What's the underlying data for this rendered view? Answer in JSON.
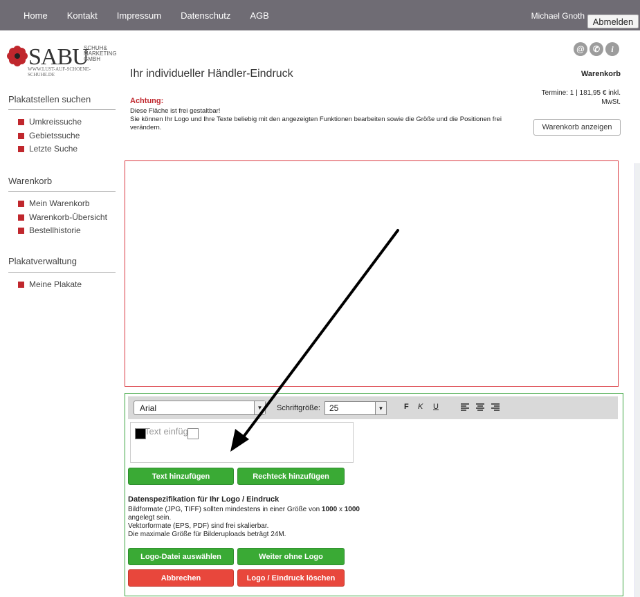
{
  "nav": {
    "items": [
      "Home",
      "Kontakt",
      "Impressum",
      "Datenschutz",
      "AGB"
    ],
    "user_name": "Michael Gnoth",
    "logout_label": "Abmelden"
  },
  "logo": {
    "name": "SABU",
    "company_line1": "SCHUH&",
    "company_line2": "MARKETING",
    "company_line3": "GMBH",
    "url": "WWW.LUST-AUF-SCHOENE-SCHUHE.DE"
  },
  "sidebar": {
    "sections": [
      {
        "title": "Plakatstellen suchen",
        "items": [
          "Umkreissuche",
          "Gebietssuche",
          "Letzte Suche"
        ]
      },
      {
        "title": "Warenkorb",
        "items": [
          "Mein Warenkorb",
          "Warenkorb-Übersicht",
          "Bestellhistorie"
        ]
      },
      {
        "title": "Plakatverwaltung",
        "items": [
          "Meine Plakate"
        ]
      }
    ]
  },
  "header": {
    "title": "Ihr individueller Händler-Eindruck",
    "warning_title": "Achtung:",
    "warning_line1": "Diese Fläche ist frei gestaltbar!",
    "warning_line2": "Sie können Ihr Logo und Ihre Texte beliebig mit den angezeigten Funktionen bearbeiten sowie die Größe und die Positionen frei verändern."
  },
  "cart": {
    "title": "Warenkorb",
    "info": "Termine: 1 | 181,95 € inkl. MwSt.",
    "button_label": "Warenkorb anzeigen",
    "icons": [
      "@",
      "✆",
      "i"
    ]
  },
  "editor": {
    "font_value": "Arial",
    "size_label": "Schriftgröße:",
    "size_value": "25",
    "bold_label": "F",
    "italic_label": "K",
    "underline_label": "U",
    "text_placeholder": "Text einfügen",
    "add_text_label": "Text hinzufügen",
    "add_rect_label": "Rechteck hinzufügen",
    "spec_title": "Datenspezifikation für Ihr Logo / Eindruck",
    "spec_line1_pre": "Bildformate (JPG, TIFF) sollten mindestens in einer Größe von ",
    "spec_w": "1000",
    "spec_x": " x ",
    "spec_h": "1000",
    "spec_line2": "angelegt sein.",
    "spec_line3": "Vektorformate (EPS, PDF) sind frei skalierbar.",
    "spec_line4": "Die maximale Größe für Bilderuploads beträgt 24M.",
    "choose_logo_label": "Logo-Datei auswählen",
    "continue_label": "Weiter ohne Logo",
    "cancel_label": "Abbrechen",
    "delete_label": "Logo / Eindruck löschen"
  },
  "colors": {
    "nav_bg": "#6f6c74",
    "accent_red": "#c0272d",
    "green": "#3aaa35",
    "red_button": "#e8473c"
  }
}
